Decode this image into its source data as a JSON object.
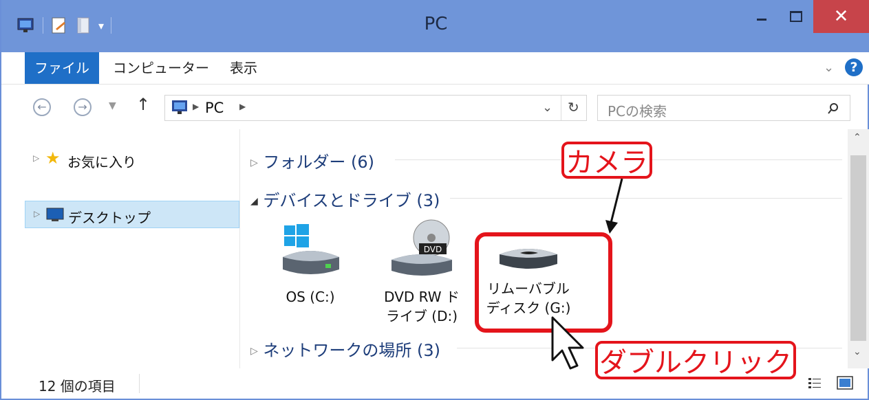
{
  "window": {
    "title": "PC",
    "controls": {
      "minimize": "–",
      "maximize": "□",
      "close": "✕"
    }
  },
  "ribbon": {
    "tabs": [
      "ファイル",
      "コンピューター",
      "表示"
    ],
    "help_label": "?"
  },
  "address": {
    "path": [
      "PC"
    ],
    "search_placeholder": "PCの検索"
  },
  "nav_pane": {
    "items": [
      {
        "label": "お気に入り",
        "icon": "star-icon"
      },
      {
        "label": "デスクトップ",
        "icon": "desktop-icon"
      }
    ]
  },
  "content": {
    "groups": [
      {
        "label": "フォルダー (6)",
        "expanded": false
      },
      {
        "label": "デバイスとドライブ (3)",
        "expanded": true
      },
      {
        "label": "ネットワークの場所 (3)",
        "expanded": false
      }
    ],
    "drives": [
      {
        "line1": "OS (C:)",
        "line2": "",
        "icon": "windows-drive-icon"
      },
      {
        "line1": "DVD RW ド",
        "line2": "ライブ (D:)",
        "icon": "dvd-drive-icon",
        "badge": "DVD"
      },
      {
        "line1": "リムーバブル",
        "line2": "ディスク (G:)",
        "icon": "removable-disk-icon"
      }
    ]
  },
  "status_bar": {
    "item_count": "12 個の項目"
  },
  "annotations": {
    "camera_label": "カメラ",
    "double_click_label": "ダブルクリック"
  },
  "colors": {
    "titlebar": "#6f95d9",
    "file_tab": "#1f6fc7",
    "annotation": "#e4141b",
    "close": "#c7444a"
  }
}
